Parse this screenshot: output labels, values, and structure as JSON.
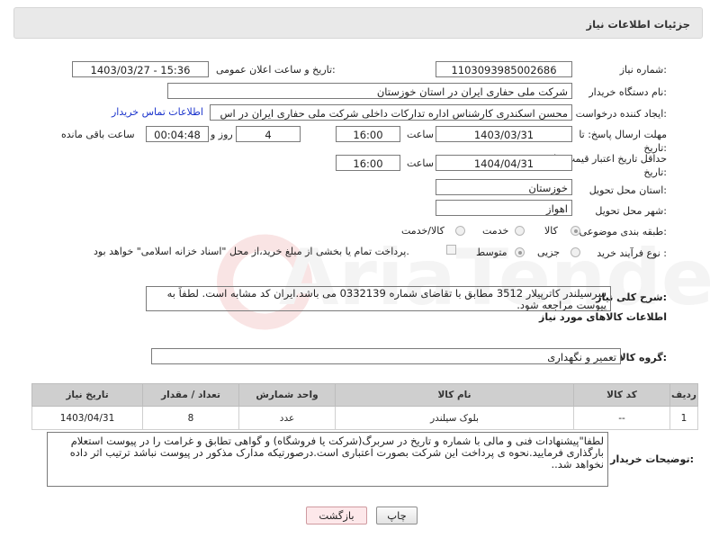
{
  "header": {
    "title": "جزئیات اطلاعات نیاز"
  },
  "form": {
    "need_number_label": "شماره نیاز:",
    "need_number": "1103093985002686",
    "announce_label": "تاریخ و ساعت اعلان عمومی:",
    "announce_value": "1403/03/27 - 15:36",
    "buyer_org_label": "نام دستگاه خریدار:",
    "buyer_org": "شرکت ملی حفاری ایران در استان خوزستان",
    "requester_label": "ایجاد کننده درخواست:",
    "requester": "محسن اسکندری کارشناس اداره تدارکات داخلی  شرکت ملی حفاری ایران در اس",
    "contact_link": "اطلاعات تماس خریدار",
    "deadline_label": "مهلت ارسال پاسخ: تا تاریخ:",
    "deadline_date": "1403/03/31",
    "time_label": "ساعت",
    "deadline_time": "16:00",
    "days_value": "4",
    "days_label": "روز و",
    "remaining_time": "00:04:48",
    "remaining_label": "ساعت باقی مانده",
    "validity_label": "حداقل تاریخ اعتبار قیمت: تا تاریخ:",
    "validity_date": "1404/04/31",
    "validity_time": "16:00",
    "province_label": "استان محل تحویل:",
    "province": "خوزستان",
    "city_label": "شهر محل تحویل:",
    "city": "اهواز",
    "category_label": "طبقه بندی موضوعی:",
    "category_options": [
      "کالا",
      "خدمت",
      "کالا/خدمت"
    ],
    "purchase_type_label": "نوع فرآیند خرید :",
    "purchase_options": [
      "جزیی",
      "متوسط"
    ],
    "treasury_note": "پرداخت تمام یا بخشی از مبلغ خرید،از محل \"اسناد خزانه اسلامی\" خواهد بود."
  },
  "description": {
    "label": "شرح کلی نیاز:",
    "text": "سرسیلندر کاترپیلار 3512 مطابق با تقاضای شماره 0332139 می باشد.ایران کد مشابه است. لطفاً به پیوست مراجعه شود."
  },
  "goods_section": {
    "title": "اطلاعات کالاهای مورد نیاز",
    "group_label": "گروه کالا:",
    "group_value": "تعمیر و نگهداری"
  },
  "table": {
    "headers": [
      "ردیف",
      "کد کالا",
      "نام کالا",
      "واحد شمارش",
      "تعداد / مقدار",
      "تاریخ نیاز"
    ],
    "rows": [
      [
        "1",
        "--",
        "بلوک سیلندر",
        "عدد",
        "8",
        "1403/04/31"
      ]
    ]
  },
  "buyer_notes": {
    "label": "توضیحات خریدار:",
    "text": "لطفا\"پیشنهادات فنی و مالی با شماره و تاریخ در سربرگ(شرکت یا فروشگاه) و گواهی تطابق و غرامت را در پیوست استعلام بارگذاری فرمایید.نحوه ی پرداخت این شرکت بصورت اعتباری است.درصورتیکه مدارک مذکور در پیوست نباشد ترتیب اثر داده نخواهد شد.."
  },
  "buttons": {
    "print": "چاپ",
    "back": "بازگشت"
  },
  "colors": {
    "link": "#1a33cc",
    "header_bg": "#e9e9e9",
    "table_header": "#cfcfcf"
  }
}
